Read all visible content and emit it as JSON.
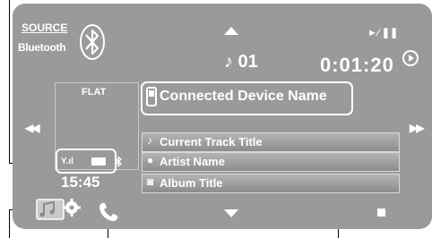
{
  "header": {
    "source_label": "SOURCE",
    "source_value": "Bluetooth",
    "play_pause": "►⁄ ❚❚"
  },
  "playback": {
    "track_number": "♪ 01",
    "elapsed_time": "0:01:20"
  },
  "equalizer": {
    "preset": "FLAT"
  },
  "device": {
    "name": "Connected Device Name"
  },
  "tracks": [
    {
      "icon": "♪",
      "label": "Current Track Title",
      "icon_name": "music-note-icon"
    },
    {
      "icon": "●",
      "label": "Artist Name",
      "icon_name": "artist-icon"
    },
    {
      "icon": "◙",
      "label": "Album Title",
      "icon_name": "album-icon"
    }
  ],
  "status": {
    "signal": "Y.ıl",
    "clock": "15:45"
  },
  "buttons": {
    "prev": "◀◀",
    "next": "▶▶"
  },
  "colors": {
    "screen_background": "#9a9a9a",
    "text": "#ffffff",
    "callout_lines": "#000000"
  }
}
